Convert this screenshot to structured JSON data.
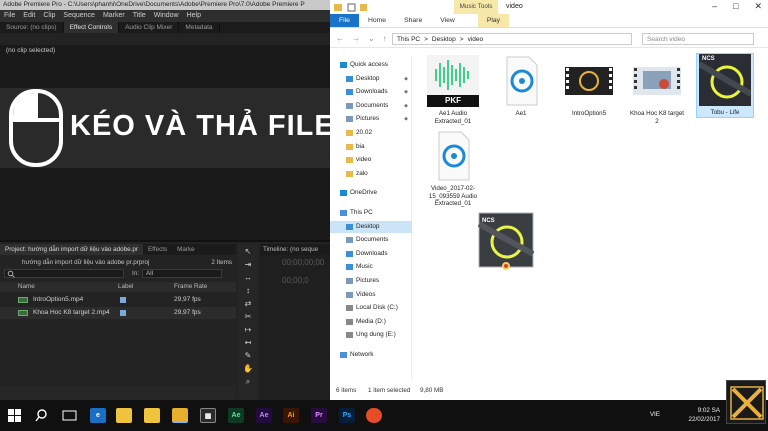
{
  "premiere": {
    "title": "Adobe Premiere Pro - C:\\Users\\phanhi\\OneDrive\\Documents\\Adobe\\Premiere Pro\\7.0\\Adobe Premiere P",
    "menu": [
      "File",
      "Edit",
      "Clip",
      "Sequence",
      "Marker",
      "Title",
      "Window",
      "Help"
    ],
    "source_tabs": [
      "Source: (no clips)",
      "Effect Controls",
      "Audio Clip Mixer",
      "Metadata"
    ],
    "no_clip": "(no clip selected)",
    "overlay_text": "KÉO VÀ THẢ FILE",
    "project_tabs": [
      "Project: hướng dẫn import dữ liệu vào adobe.pr",
      "Effects",
      "Marke"
    ],
    "project_file": "hướng dẫn import dữ liệu vào adobe pr.prproj",
    "project_items": "2 Items",
    "in_label": "In:",
    "in_value": "All",
    "columns": [
      "Name",
      "Label",
      "Frame Rate"
    ],
    "rows": [
      {
        "name": "IntroOption5.mp4",
        "fps": "29,97 fps"
      },
      {
        "name": "Khoa Hoc K8 target 2.mp4",
        "fps": "29,97 fps"
      }
    ],
    "timeline_tab": "Timeline: (no seque",
    "timecode1": "00;00;00;00",
    "timecode2": "00;00;0"
  },
  "explorer": {
    "music_tools": "Music Tools",
    "window_title": "video",
    "ribbon": [
      "File",
      "Home",
      "Share",
      "View",
      "Play"
    ],
    "path": [
      "This PC",
      ">",
      "Desktop",
      ">",
      "video"
    ],
    "search_placeholder": "Search video",
    "nav": [
      {
        "label": "Quick access",
        "pin": false,
        "sel": false
      },
      {
        "label": "Desktop",
        "pin": true,
        "sel": false
      },
      {
        "label": "Downloads",
        "pin": true,
        "sel": false
      },
      {
        "label": "Documents",
        "pin": true,
        "sel": false
      },
      {
        "label": "Pictures",
        "pin": true,
        "sel": false
      },
      {
        "label": "20.02",
        "pin": false,
        "sel": false
      },
      {
        "label": "bia",
        "pin": false,
        "sel": false
      },
      {
        "label": "video",
        "pin": false,
        "sel": false
      },
      {
        "label": "zalo",
        "pin": false,
        "sel": false
      },
      {
        "label": "OneDrive",
        "pin": false,
        "sel": false
      },
      {
        "label": "This PC",
        "pin": false,
        "sel": false
      },
      {
        "label": "Desktop",
        "pin": false,
        "sel": true
      },
      {
        "label": "Documents",
        "pin": false,
        "sel": false
      },
      {
        "label": "Downloads",
        "pin": false,
        "sel": false
      },
      {
        "label": "Music",
        "pin": false,
        "sel": false
      },
      {
        "label": "Pictures",
        "pin": false,
        "sel": false
      },
      {
        "label": "Videos",
        "pin": false,
        "sel": false
      },
      {
        "label": "Local Disk (C:)",
        "pin": false,
        "sel": false
      },
      {
        "label": "Media (D:)",
        "pin": false,
        "sel": false
      },
      {
        "label": "Ung dung (E:)",
        "pin": false,
        "sel": false
      },
      {
        "label": "Network",
        "pin": false,
        "sel": false
      }
    ],
    "files": [
      {
        "name": "Ae1 Audio Extracted_01",
        "badge": "PKF"
      },
      {
        "name": "Ae1"
      },
      {
        "name": "IntroOption5"
      },
      {
        "name": "Khoa Hoc K8 target 2"
      },
      {
        "name": "Tobu - Life",
        "badge": "NCS"
      },
      {
        "name": "Video_2017-02-15_093559 Audio Extracted_01"
      }
    ],
    "status_count": "6 items",
    "status_selected": "1 item selected",
    "status_size": "9,80 MB"
  },
  "taskbar": {
    "lang": "VIE",
    "time": "9:02 SA",
    "date": "22/02/2017",
    "apps": [
      "Ae",
      "Ae",
      "Ai",
      "Pr",
      "Ps"
    ]
  }
}
